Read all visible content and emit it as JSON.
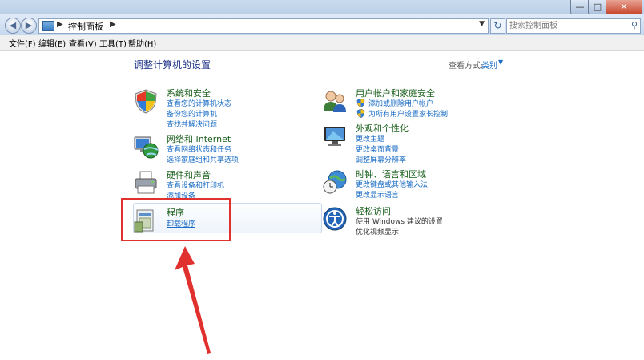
{
  "address": {
    "breadcrumb": "控制面板",
    "search_placeholder": "搜索控制面板"
  },
  "menu": {
    "file": "文件(F)",
    "edit": "编辑(E)",
    "view": "查看(V)",
    "tools": "工具(T)",
    "help": "帮助(H)"
  },
  "main": {
    "heading": "调整计算机的设置",
    "view_by_label": "查看方式:",
    "view_by_value": "类别"
  },
  "categories_left": [
    {
      "title": "系统和安全",
      "links": [
        "查看您的计算机状态",
        "备份您的计算机",
        "查找并解决问题"
      ],
      "icon": "shield-icon"
    },
    {
      "title": "网络和 Internet",
      "links": [
        "查看网络状态和任务",
        "选择家庭组和共享选项"
      ],
      "icon": "network-globe-icon"
    },
    {
      "title": "硬件和声音",
      "links": [
        "查看设备和打印机",
        "添加设备"
      ],
      "icon": "printer-icon"
    },
    {
      "title": "程序",
      "links": [
        "卸载程序"
      ],
      "icon": "programs-icon"
    }
  ],
  "categories_right": [
    {
      "title": "用户帐户和家庭安全",
      "links": [
        "添加或删除用户帐户",
        "为所有用户设置家长控制"
      ],
      "icon": "users-icon"
    },
    {
      "title": "外观和个性化",
      "links": [
        "更改主题",
        "更改桌面背景",
        "调整屏幕分辨率"
      ],
      "icon": "display-icon"
    },
    {
      "title": "时钟、语言和区域",
      "links": [
        "更改键盘或其他输入法",
        "更改显示语言"
      ],
      "icon": "clock-globe-icon"
    },
    {
      "title": "轻松访问",
      "links": [
        "使用 Windows 建议的设置",
        "优化视频显示"
      ],
      "icon": "accessibility-icon"
    }
  ],
  "colors": {
    "title_green": "#1a5f1c",
    "link_blue": "#1a6cc4",
    "heading_blue": "#1e3287",
    "annotation_red": "#e0312f"
  }
}
